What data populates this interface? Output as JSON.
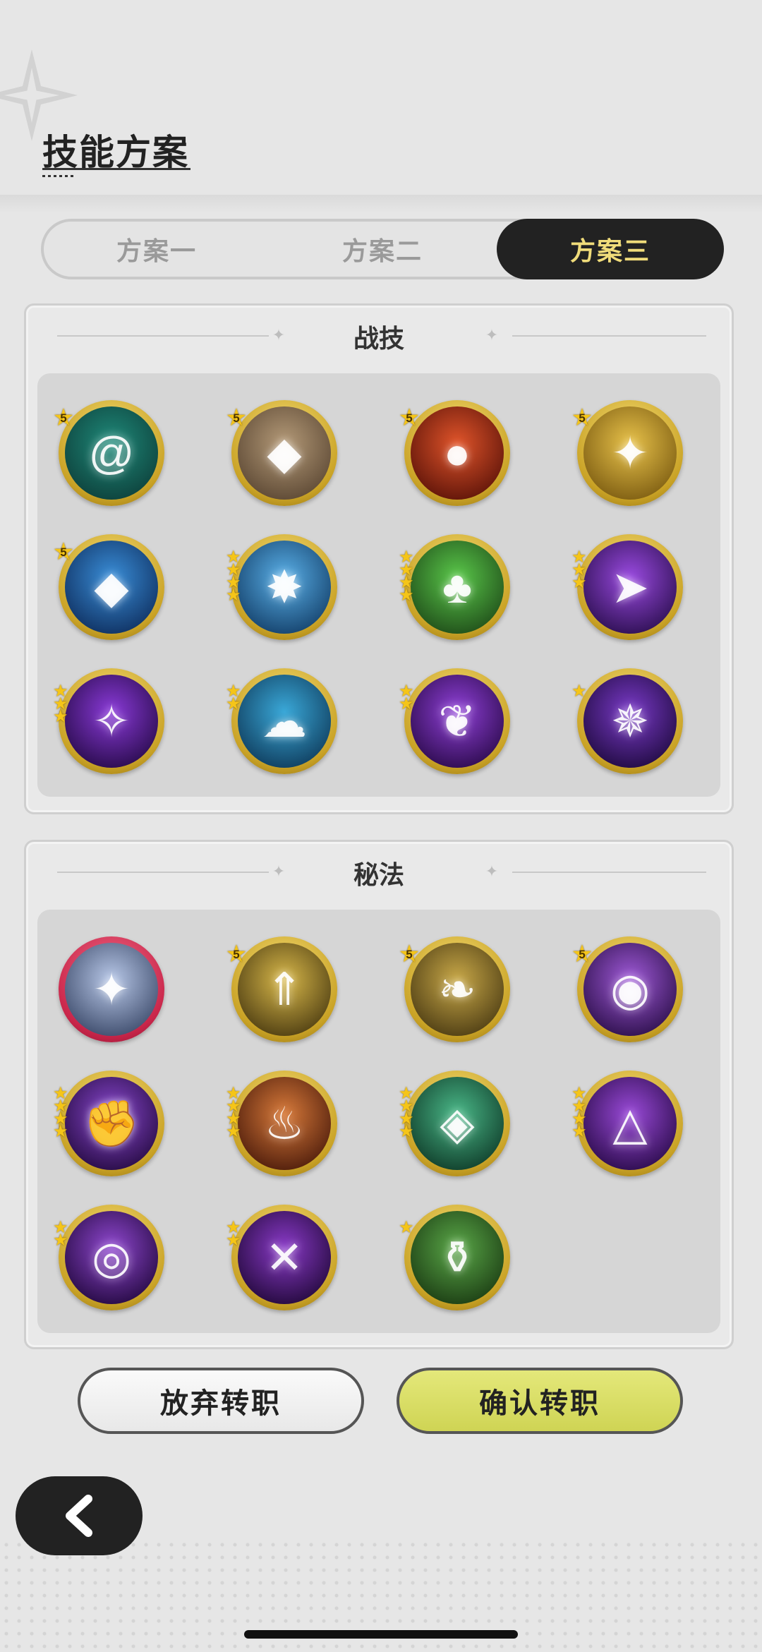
{
  "header": {
    "title": "技能方案"
  },
  "tabs": [
    {
      "label": "方案一",
      "selected": false
    },
    {
      "label": "方案二",
      "selected": false
    },
    {
      "label": "方案三",
      "selected": true
    }
  ],
  "sections": {
    "combat": {
      "title": "战技",
      "skills": [
        {
          "icon": "vortex-icon",
          "rank": "5",
          "stars": 0,
          "colors": [
            "#1f8a7a",
            "#0d3f3a"
          ]
        },
        {
          "icon": "rock-shards-icon",
          "rank": "5",
          "stars": 0,
          "colors": [
            "#b49a78",
            "#5a4632"
          ]
        },
        {
          "icon": "fireball-icon",
          "rank": "5",
          "stars": 0,
          "colors": [
            "#e0542a",
            "#5a1208"
          ]
        },
        {
          "icon": "golden-sparkles-icon",
          "rank": "5",
          "stars": 0,
          "colors": [
            "#e8c24a",
            "#7a5a10"
          ]
        },
        {
          "icon": "ice-crystal-icon",
          "rank": "5",
          "stars": 0,
          "colors": [
            "#3a8ed8",
            "#0e2e5e"
          ]
        },
        {
          "icon": "ice-burst-icon",
          "rank": "",
          "stars": 4,
          "colors": [
            "#5ab0e8",
            "#123e68"
          ]
        },
        {
          "icon": "tree-stump-icon",
          "rank": "",
          "stars": 4,
          "colors": [
            "#5ac84a",
            "#1e4a18"
          ]
        },
        {
          "icon": "arcane-arrow-icon",
          "rank": "",
          "stars": 3,
          "colors": [
            "#9a4ae0",
            "#2a0e4e"
          ]
        },
        {
          "icon": "arcane-slash-icon",
          "rank": "",
          "stars": 3,
          "colors": [
            "#8a3ad8",
            "#260a48"
          ]
        },
        {
          "icon": "water-spirit-icon",
          "rank": "",
          "stars": 2,
          "colors": [
            "#3aa8d8",
            "#0e3a5a"
          ]
        },
        {
          "icon": "arcane-wings-icon",
          "rank": "",
          "stars": 2,
          "colors": [
            "#9040d8",
            "#2a0a4a"
          ]
        },
        {
          "icon": "arcane-crest-icon",
          "rank": "",
          "stars": 1,
          "colors": [
            "#7a3ac8",
            "#1e0a3e"
          ]
        }
      ]
    },
    "arcane": {
      "title": "秘法",
      "skills": [
        {
          "icon": "star-orb-icon",
          "rank": "",
          "stars": 0,
          "ring": "red",
          "colors": [
            "#b8c8e8",
            "#3a4868"
          ]
        },
        {
          "icon": "golden-arrows-icon",
          "rank": "5",
          "stars": 0,
          "colors": [
            "#d8b84a",
            "#4a3a10"
          ]
        },
        {
          "icon": "golden-wing-icon",
          "rank": "5",
          "stars": 0,
          "colors": [
            "#c8a848",
            "#4a3a12"
          ]
        },
        {
          "icon": "arcane-eye-icon",
          "rank": "5",
          "stars": 0,
          "colors": [
            "#a05ad8",
            "#2a0e48"
          ]
        },
        {
          "icon": "arcane-fist-icon",
          "rank": "",
          "stars": 4,
          "colors": [
            "#8a48d0",
            "#240a40"
          ]
        },
        {
          "icon": "flame-beast-icon",
          "rank": "",
          "stars": 4,
          "colors": [
            "#d87a3a",
            "#4a1a0a"
          ]
        },
        {
          "icon": "verdant-shards-icon",
          "rank": "",
          "stars": 4,
          "colors": [
            "#4ab888",
            "#0e3a28"
          ]
        },
        {
          "icon": "arcane-triangle-icon",
          "rank": "",
          "stars": 4,
          "colors": [
            "#9a4ad8",
            "#280a48"
          ]
        },
        {
          "icon": "void-eye-icon",
          "rank": "",
          "stars": 2,
          "colors": [
            "#9048d0",
            "#22083e"
          ]
        },
        {
          "icon": "rune-cross-icon",
          "rank": "",
          "stars": 2,
          "colors": [
            "#8a3ac8",
            "#200838"
          ]
        },
        {
          "icon": "potion-icon",
          "rank": "",
          "stars": 1,
          "colors": [
            "#5aa848",
            "#1a3a12"
          ]
        }
      ]
    }
  },
  "buttons": {
    "abandon": "放弃转职",
    "confirm": "确认转职"
  }
}
